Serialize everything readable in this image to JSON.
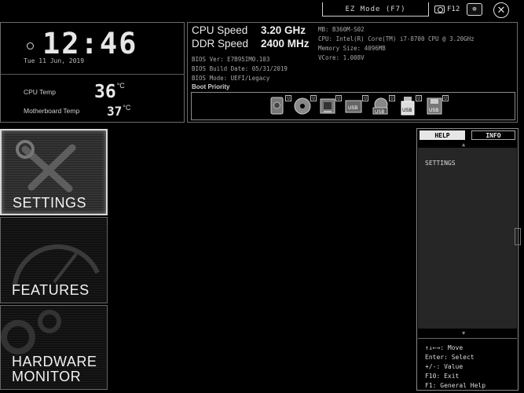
{
  "topbar": {
    "ez_mode_label": "EZ Mode (F7)",
    "screenshot_label": "F12",
    "language_icon": "globe-language-icon",
    "close_icon": "close-icon"
  },
  "clock": {
    "time": "12:46",
    "date": "Tue  11 Jun, 2019"
  },
  "temps": {
    "cpu_label": "CPU Temp",
    "cpu_value": "36",
    "cpu_unit": "°C",
    "mb_label": "Motherboard Temp",
    "mb_value": "37",
    "mb_unit": "°C"
  },
  "speeds": {
    "cpu_label": "CPU Speed",
    "cpu_value": "3.20 GHz",
    "ddr_label": "DDR Speed",
    "ddr_value": "2400 MHz"
  },
  "bios": {
    "ver": "BIOS Ver: E7B95IM0.103",
    "date": "BIOS Build Date: 05/31/2019",
    "mode": "BIOS Mode: UEFI/Legacy",
    "boot_priority": "Boot Priority"
  },
  "sysinfo": {
    "mb": "MB: B360M-S02",
    "cpu": "CPU: Intel(R) Core(TM) i7-8700 CPU @ 3.20GHz",
    "memory": "Memory Size: 4096MB",
    "vcore": "VCore: 1.008V"
  },
  "boot_devices": [
    {
      "icon": "hard-drive-icon",
      "num": "U"
    },
    {
      "icon": "optical-disc-icon",
      "num": "U"
    },
    {
      "icon": "network-card-icon",
      "num": "U"
    },
    {
      "icon": "usb-drive-icon",
      "num": "U",
      "label": "USB"
    },
    {
      "icon": "usb-optical-icon",
      "num": "U",
      "label": "USB"
    },
    {
      "icon": "usb-key-icon",
      "num": "U",
      "label": "USB"
    },
    {
      "icon": "usb-floppy-icon",
      "num": "U",
      "label": "USB"
    }
  ],
  "nav": {
    "settings": "SETTINGS",
    "features": "FEATURES",
    "hardware1": "HARDWARE",
    "hardware2": "MONITOR"
  },
  "help": {
    "tab_help": "HELP",
    "tab_info": "INFO",
    "content": "SETTINGS",
    "keys": [
      "↑↓←→: Move",
      "Enter: Select",
      "+/-: Value",
      "F10: Exit",
      "F1: General Help"
    ]
  }
}
